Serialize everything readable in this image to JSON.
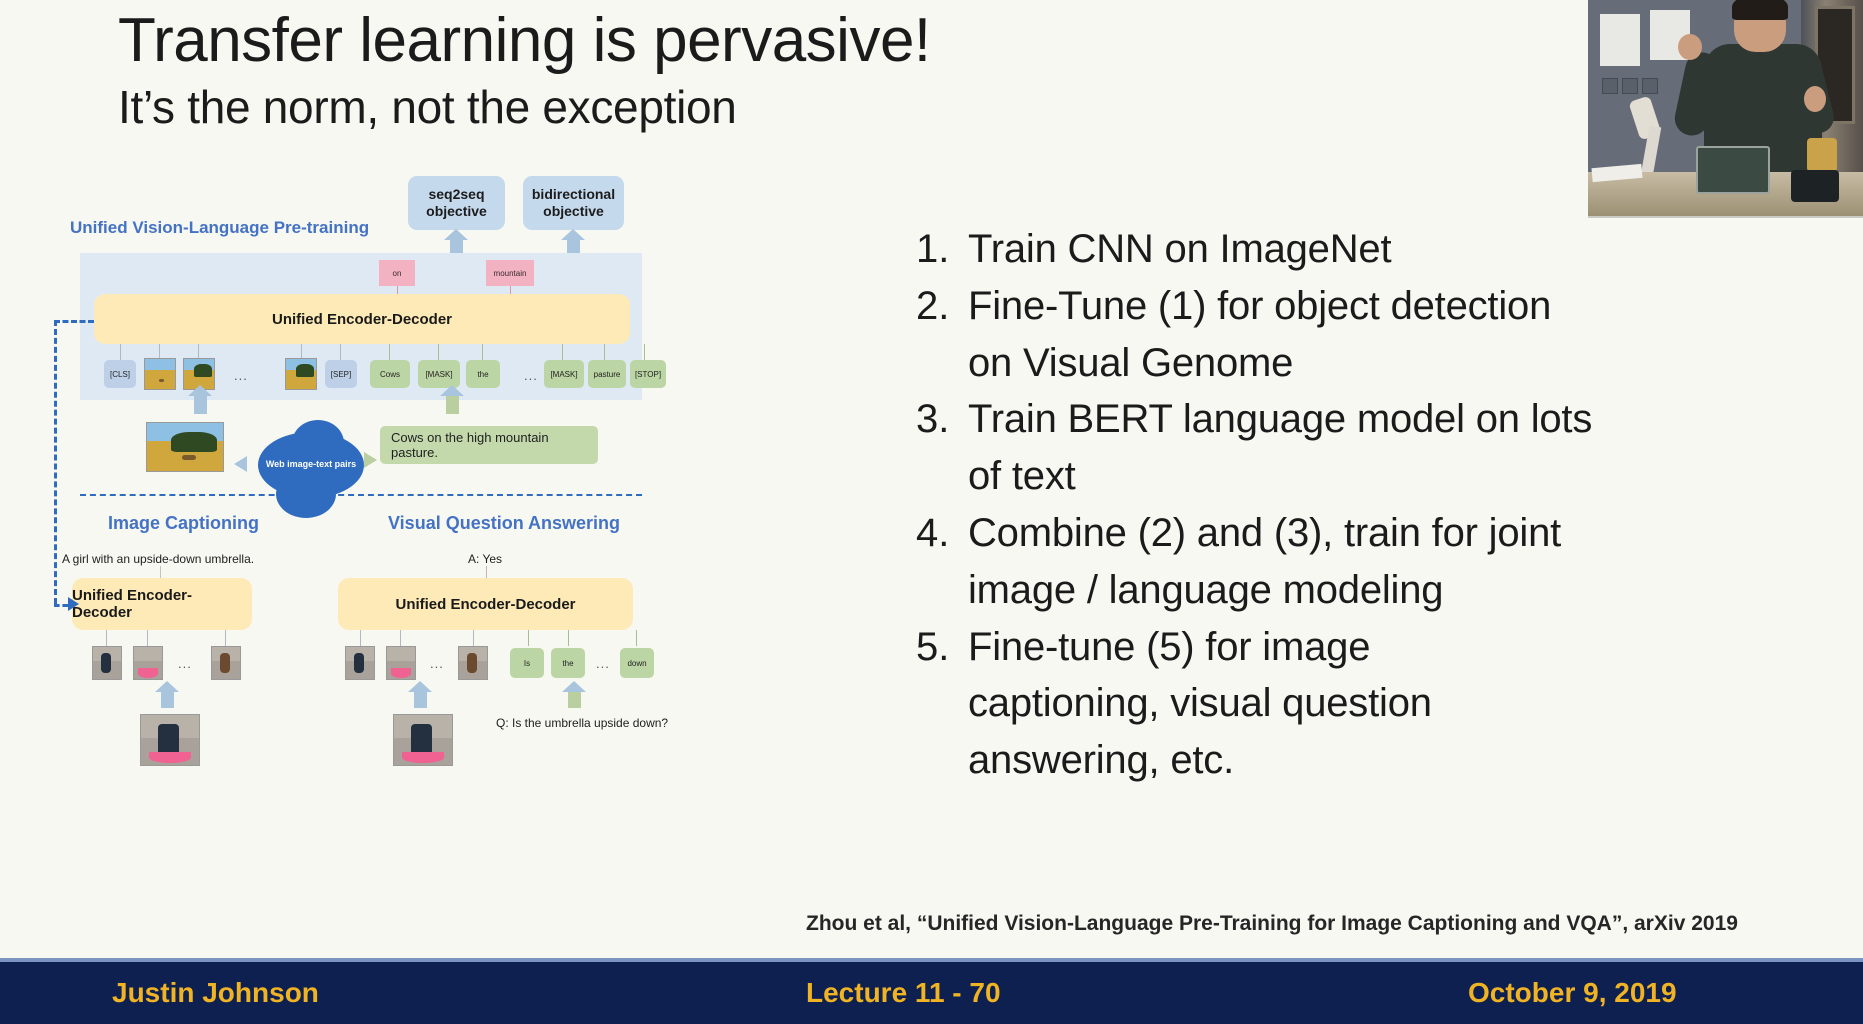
{
  "slide": {
    "title": "Transfer learning is pervasive!",
    "subtitle": "It’s the norm, not the exception",
    "background_color": "#f7f8f2"
  },
  "steps": [
    {
      "num": "1.",
      "text": "Train CNN on ImageNet"
    },
    {
      "num": "2.",
      "text": "Fine-Tune (1) for object detection"
    },
    {
      "num": "",
      "text": "on Visual Genome"
    },
    {
      "num": "3.",
      "text": "Train BERT language model on lots"
    },
    {
      "num": "",
      "text": "of text"
    },
    {
      "num": "4.",
      "text": "Combine (2) and (3), train for joint"
    },
    {
      "num": "",
      "text": "image / language modeling"
    },
    {
      "num": "5.",
      "text": "Fine-tune (5) for image"
    },
    {
      "num": "",
      "text": "captioning, visual question"
    },
    {
      "num": "",
      "text": "answering, etc."
    }
  ],
  "citation": "Zhou et al, “Unified Vision-Language Pre-Training for Image Captioning and VQA”, arXiv 2019",
  "footer": {
    "author": "Justin Johnson",
    "lecture": "Lecture 11 - 70",
    "date": "October 9, 2019",
    "background_color": "#0e2050",
    "text_color": "#f0b323"
  },
  "figure": {
    "pretrain_label": "Unified Vision-Language Pre-training",
    "objectives": [
      {
        "line1": "seq2seq",
        "line2": "objective"
      },
      {
        "line1": "bidirectional",
        "line2": "objective"
      }
    ],
    "encoder_label": "Unified Encoder-Decoder",
    "predicted_tokens": [
      "on",
      "mountain"
    ],
    "input_tokens": [
      {
        "label": "[CLS]",
        "kind": "blue"
      },
      {
        "label": "",
        "kind": "image"
      },
      {
        "label": "",
        "kind": "image"
      },
      {
        "label": "...",
        "kind": "ellipsis"
      },
      {
        "label": "",
        "kind": "image"
      },
      {
        "label": "[SEP]",
        "kind": "blue"
      },
      {
        "label": "Cows",
        "kind": "green"
      },
      {
        "label": "[MASK]",
        "kind": "green"
      },
      {
        "label": "the",
        "kind": "green"
      },
      {
        "label": "...",
        "kind": "ellipsis"
      },
      {
        "label": "[MASK]",
        "kind": "green"
      },
      {
        "label": "pasture",
        "kind": "green"
      },
      {
        "label": "[STOP]",
        "kind": "green"
      }
    ],
    "cloud_label": "Web image-text pairs",
    "caption_sentence": "Cows on the high mountain pasture.",
    "tasks": [
      {
        "title": "Image Captioning",
        "output": "A girl with an upside-down umbrella.",
        "encoder_label": "Unified Encoder-Decoder",
        "tokens": [
          "",
          "",
          "...",
          ""
        ]
      },
      {
        "title": "Visual Question Answering",
        "output": "A: Yes",
        "encoder_label": "Unified Encoder-Decoder",
        "image_tokens": [
          "",
          "",
          "...",
          ""
        ],
        "text_tokens": [
          "Is",
          "the",
          "...",
          "down"
        ],
        "question": "Q: Is the umbrella upside down?"
      }
    ],
    "colors": {
      "panel_blue": "#dfe9f3",
      "encoder_yellow": "#fdeab6",
      "token_blue": "#bdd0e8",
      "token_green": "#bcd5a4",
      "predicted_pink": "#f3b2c2",
      "cloud_blue": "#2f6cc0",
      "label_blue": "#4472c4"
    }
  }
}
